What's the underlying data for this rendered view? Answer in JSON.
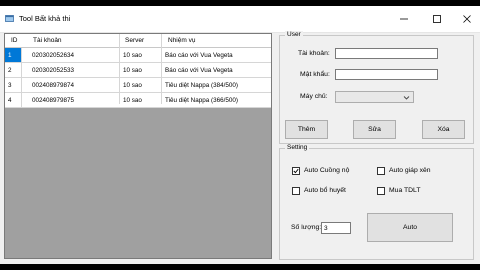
{
  "window": {
    "title": "Tool Bất khả thi"
  },
  "grid": {
    "columns": [
      "ID",
      "Tài khoản",
      "Server",
      "Nhiệm vụ"
    ],
    "rows": [
      {
        "id": "1",
        "account": "020302052634",
        "server": "10 sao",
        "task": "Báo cáo với Vua Vegeta",
        "selected": true
      },
      {
        "id": "2",
        "account": "020302052533",
        "server": "10 sao",
        "task": "Báo cáo với Vua Vegeta",
        "selected": false
      },
      {
        "id": "3",
        "account": "002408979874",
        "server": "10 sao",
        "task": "Tiêu diệt Nappa (384/500)",
        "selected": false
      },
      {
        "id": "4",
        "account": "002408979875",
        "server": "10 sao",
        "task": "Tiêu diệt Nappa (366/500)",
        "selected": false
      }
    ]
  },
  "user": {
    "group_title": "User",
    "account_label": "Tài khoản:",
    "account_value": "",
    "password_label": "Mật khẩu:",
    "password_value": "",
    "server_label": "Máy chủ:",
    "server_value": "",
    "add_button": "Thêm",
    "edit_button": "Sửa",
    "delete_button": "Xóa"
  },
  "setting": {
    "group_title": "Setting",
    "auto_cuong_no": {
      "label": "Auto Cuồng nộ",
      "checked": true
    },
    "auto_giap_xen": {
      "label": "Auto giáp xên",
      "checked": false
    },
    "auto_bo_huyet": {
      "label": "Auto bổ huyết",
      "checked": false
    },
    "mua_tdlt": {
      "label": "Mua TDLT",
      "checked": false
    },
    "quantity_label": "Số lượng:",
    "quantity_value": "3",
    "auto_button": "Auto"
  },
  "colors": {
    "selection": "#0078d7",
    "grid_background": "#a0a0a0",
    "window_background": "#f0f0f0"
  },
  "icons": [
    "app-icon",
    "minimize-icon",
    "maximize-icon",
    "close-icon",
    "chevron-down-icon",
    "checkmark-icon"
  ]
}
